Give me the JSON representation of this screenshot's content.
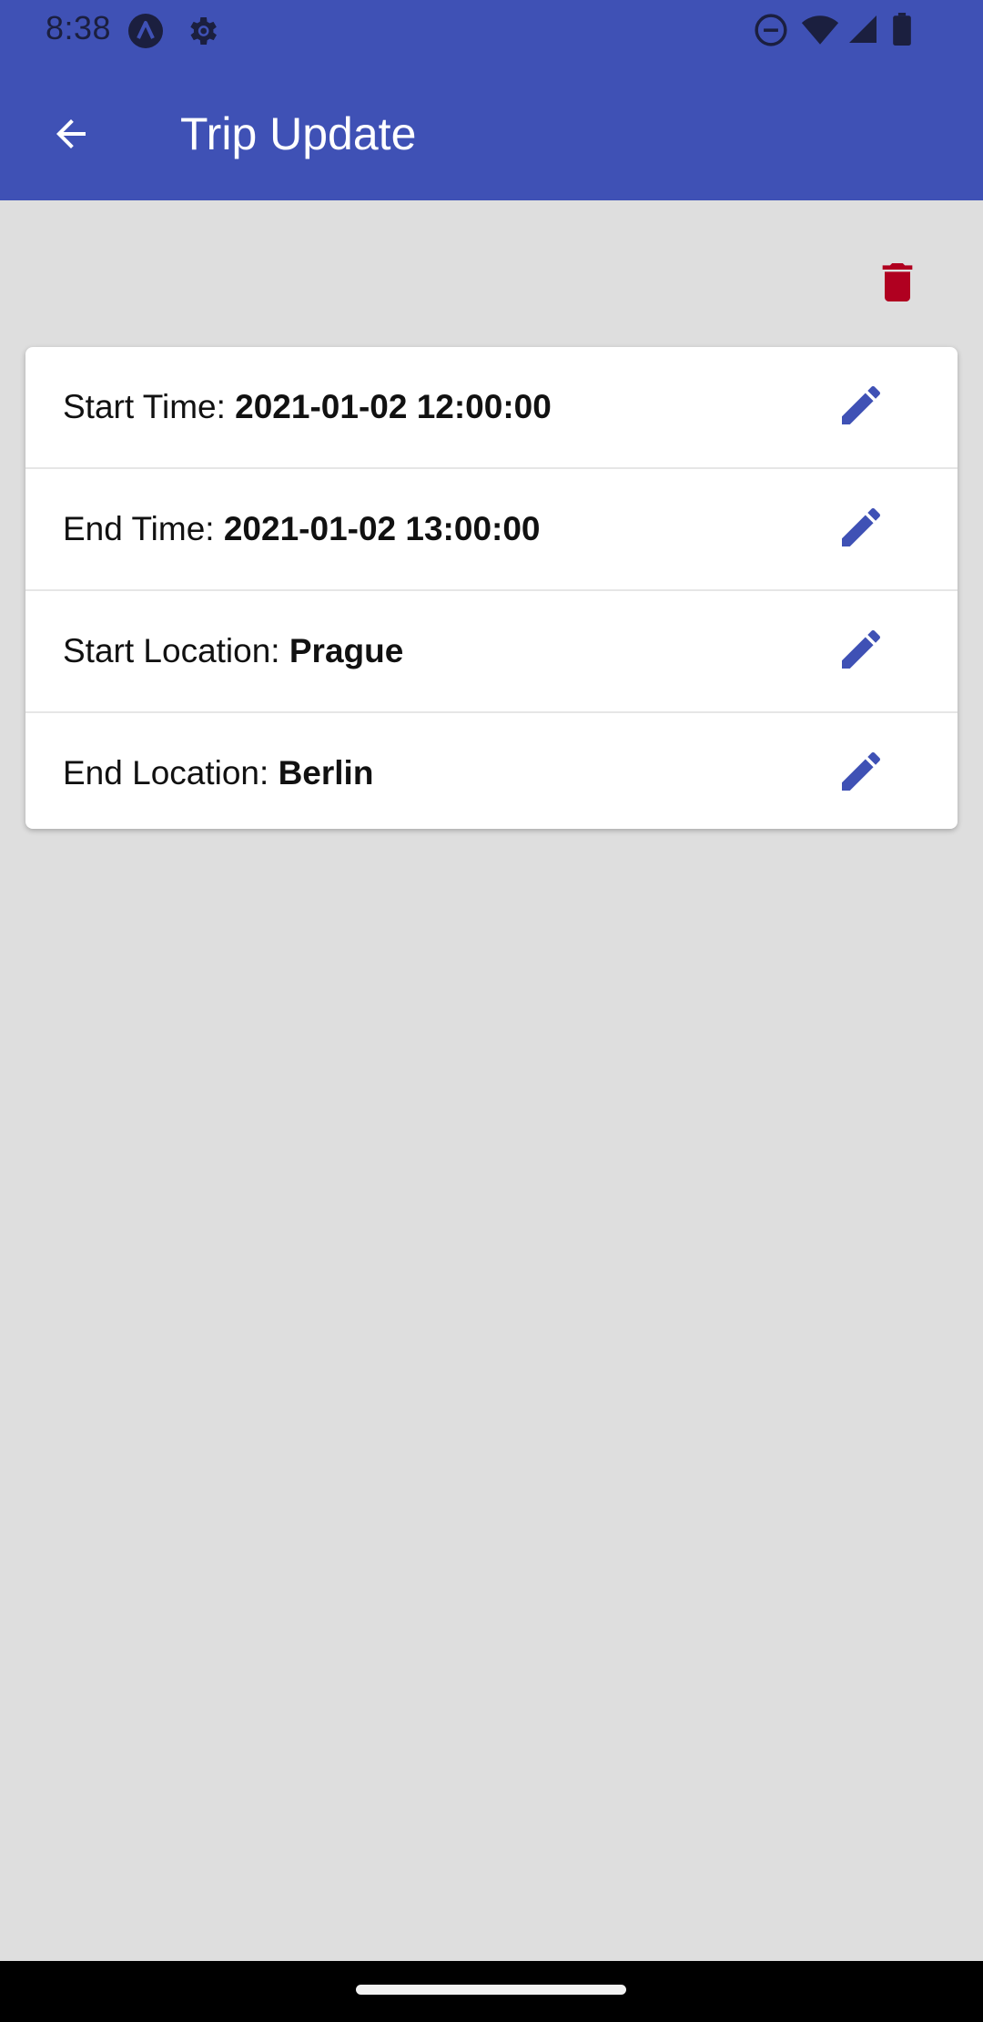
{
  "status_bar": {
    "time": "8:38",
    "icons": [
      "a-notification-icon",
      "settings-gear-icon",
      "do-not-disturb-icon",
      "wifi-icon",
      "cell-signal-icon",
      "battery-icon"
    ]
  },
  "app_bar": {
    "title": "Trip Update",
    "back_icon": "arrow-back-icon",
    "background": "#3F51B5"
  },
  "actions": {
    "delete_icon": "trash-icon",
    "delete_color": "#B00020"
  },
  "trip": {
    "rows": [
      {
        "label": "Start Time: ",
        "value": "2021-01-02 12:00:00"
      },
      {
        "label": "End Time: ",
        "value": "2021-01-02 13:00:00"
      },
      {
        "label": "Start Location: ",
        "value": "Prague"
      },
      {
        "label": "End Location: ",
        "value": "Berlin"
      }
    ],
    "edit_icon": "pencil-icon",
    "edit_color": "#3F51B5"
  }
}
